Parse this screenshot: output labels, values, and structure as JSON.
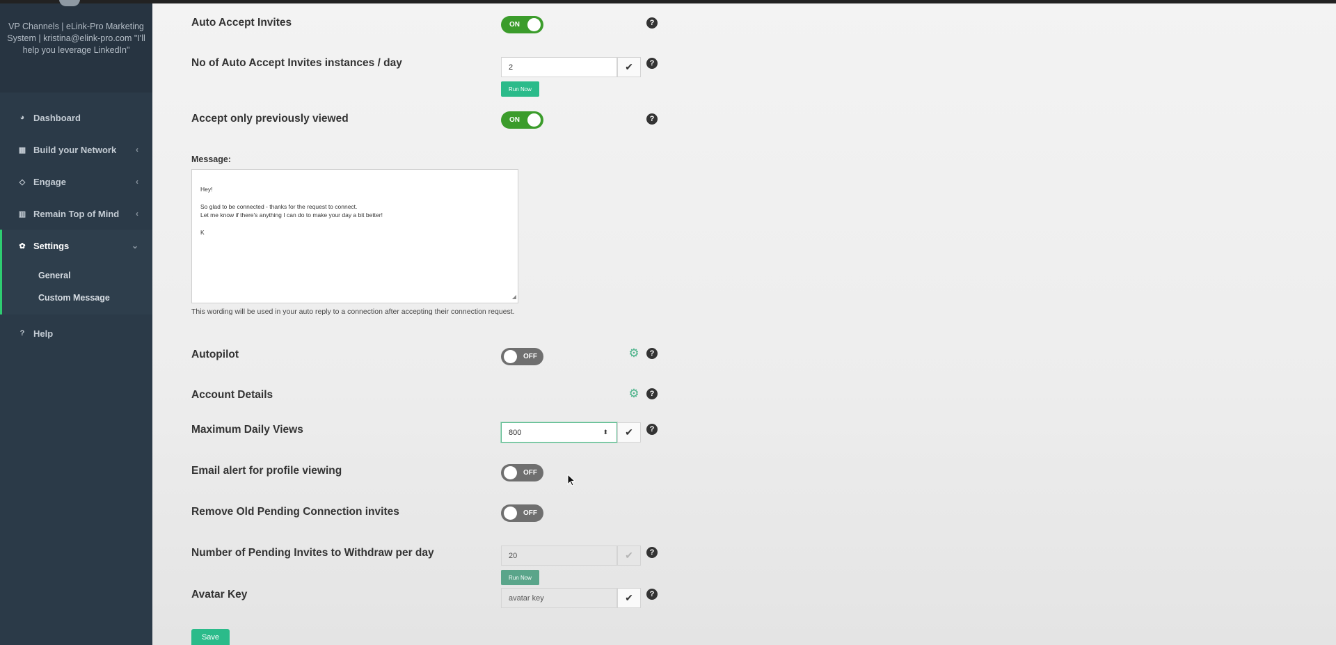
{
  "sidebar": {
    "profile_text": "VP Channels | eLink-Pro Marketing System | kristina@elink-pro.com \"I'll help you leverage LinkedIn\"",
    "items": [
      {
        "label": "Dashboard",
        "icon": "dashboard-icon"
      },
      {
        "label": "Build your Network",
        "icon": "grid-icon"
      },
      {
        "label": "Engage",
        "icon": "diamond-icon"
      },
      {
        "label": "Remain Top of Mind",
        "icon": "bar-chart-icon"
      },
      {
        "label": "Settings",
        "icon": "gear-icon"
      },
      {
        "label": "Help",
        "icon": "question-icon"
      }
    ],
    "sub_items": [
      "General",
      "Custom Message"
    ]
  },
  "settings": {
    "auto_accept": {
      "label": "Auto Accept Invites",
      "state": "ON"
    },
    "auto_accept_instances": {
      "label": "No of Auto Accept Invites instances / day",
      "value": "2",
      "button": "Run Now"
    },
    "accept_viewed": {
      "label": "Accept only previously viewed",
      "state": "ON"
    },
    "message": {
      "label": "Message:",
      "text": "Hey!\n\nSo glad to be connected - thanks for the request to connect.\nLet me know if there's anything I can do to make your day a bit better!\n\nK",
      "hint": "This wording will be used in your auto reply to a connection after accepting their connection request."
    },
    "autopilot": {
      "label": "Autopilot",
      "state": "OFF"
    },
    "account_details": {
      "label": "Account Details"
    },
    "max_daily_views": {
      "label": "Maximum Daily Views",
      "value": "800"
    },
    "email_alert": {
      "label": "Email alert for profile viewing",
      "state": "OFF"
    },
    "remove_pending": {
      "label": "Remove Old Pending Connection invites",
      "state": "OFF"
    },
    "pending_withdraw": {
      "label": "Number of Pending Invites to Withdraw per day",
      "value": "20",
      "button": "Run Now"
    },
    "avatar_key": {
      "label": "Avatar Key",
      "value": "avatar key"
    },
    "save_label": "Save"
  },
  "icons": {
    "check": "✔",
    "help": "?",
    "gear": "⚙"
  },
  "colors": {
    "accent": "#2bbb8a",
    "toggle_on": "#3b9c2b",
    "toggle_off": "#6f6f6f",
    "sidebar": "#2b3a48"
  }
}
